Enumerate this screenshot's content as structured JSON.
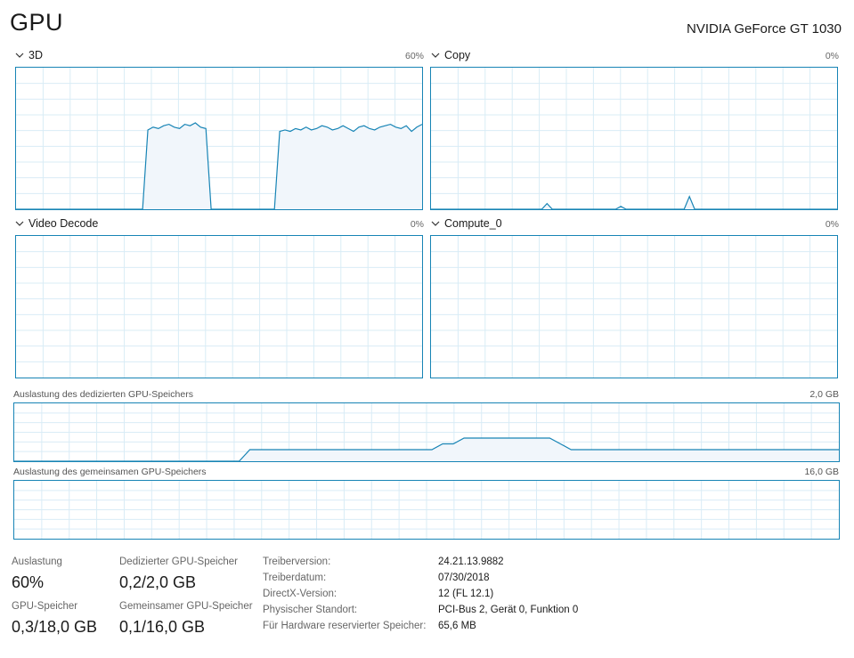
{
  "header": {
    "title": "GPU",
    "gpu_name": "NVIDIA GeForce GT 1030"
  },
  "engines": [
    {
      "label": "3D",
      "max": "60%",
      "util_percent": [
        0,
        0,
        0,
        0,
        0,
        0,
        0,
        0,
        0,
        0,
        0,
        0,
        0,
        0,
        0,
        0,
        0,
        0,
        0,
        0,
        0,
        0,
        0,
        0,
        0,
        56,
        58,
        57,
        59,
        60,
        58,
        57,
        60,
        59,
        61,
        58,
        57,
        0,
        0,
        0,
        0,
        0,
        0,
        0,
        0,
        0,
        0,
        0,
        0,
        0,
        55,
        56,
        55,
        57,
        56,
        58,
        56,
        57,
        59,
        58,
        56,
        57,
        59,
        57,
        55,
        58,
        59,
        57,
        56,
        58,
        59,
        60,
        58,
        57,
        59,
        55,
        58,
        60
      ]
    },
    {
      "label": "Copy",
      "max": "0%",
      "util_percent": [
        0,
        0,
        0,
        0,
        0,
        0,
        0,
        0,
        0,
        0,
        0,
        0,
        0,
        0,
        0,
        0,
        0,
        0,
        0,
        0,
        0,
        0,
        4,
        0,
        0,
        0,
        0,
        0,
        0,
        0,
        0,
        0,
        0,
        0,
        0,
        0,
        2,
        0,
        0,
        0,
        0,
        0,
        0,
        0,
        0,
        0,
        0,
        0,
        0,
        9,
        0,
        0,
        0,
        0,
        0,
        0,
        0,
        0,
        0,
        0,
        0,
        0,
        0,
        0,
        0,
        0,
        0,
        0,
        0,
        0,
        0,
        0,
        0,
        0,
        0,
        0,
        0,
        0
      ]
    },
    {
      "label": "Video Decode",
      "max": "0%",
      "util_percent": []
    },
    {
      "label": "Compute_0",
      "max": "0%",
      "util_percent": []
    }
  ],
  "dedicated_memory": {
    "label": "Auslastung des dedizierten GPU-Speichers",
    "max": "2,0 GB",
    "used_fraction": [
      0,
      0,
      0,
      0,
      0,
      0,
      0,
      0,
      0,
      0,
      0,
      0,
      0,
      0,
      0,
      0,
      0,
      0,
      0,
      0,
      0,
      0,
      0.02,
      0.02,
      0.02,
      0.02,
      0.02,
      0.02,
      0.02,
      0.02,
      0.02,
      0.02,
      0.02,
      0.02,
      0.02,
      0.02,
      0.02,
      0.02,
      0.02,
      0.02,
      0.03,
      0.03,
      0.04,
      0.04,
      0.04,
      0.04,
      0.04,
      0.04,
      0.04,
      0.04,
      0.04,
      0.03,
      0.02,
      0.02,
      0.02,
      0.02,
      0.02,
      0.02,
      0.02,
      0.02,
      0.02,
      0.02,
      0.02,
      0.02,
      0.02,
      0.02,
      0.02,
      0.02,
      0.02,
      0.02,
      0.02,
      0.02,
      0.02,
      0.02,
      0.02,
      0.02,
      0.02,
      0.02
    ]
  },
  "shared_memory": {
    "label": "Auslastung des gemeinsamen GPU-Speichers",
    "max": "16,0 GB",
    "used_fraction": []
  },
  "stats": {
    "utilization_label": "Auslastung",
    "utilization_value": "60%",
    "gpu_memory_label": "GPU-Speicher",
    "gpu_memory_value": "0,3/18,0 GB",
    "dedicated_label": "Dedizierter GPU-Speicher",
    "dedicated_value": "0,2/2,0 GB",
    "shared_label": "Gemeinsamer GPU-Speicher",
    "shared_value": "0,1/16,0 GB"
  },
  "details": [
    {
      "key": "Treiberversion:",
      "value": "24.21.13.9882"
    },
    {
      "key": "Treiberdatum:",
      "value": "07/30/2018"
    },
    {
      "key": "DirectX-Version:",
      "value": "12 (FL 12.1)"
    },
    {
      "key": "Physischer Standort:",
      "value": "PCI-Bus 2, Gerät 0, Funktion 0"
    },
    {
      "key": "Für Hardware reservierter Speicher:",
      "value": "65,6 MB"
    }
  ],
  "colors": {
    "graph_line": "#1784b5",
    "graph_fill": "#f1f6fb",
    "grid": "#d9ecf6"
  }
}
